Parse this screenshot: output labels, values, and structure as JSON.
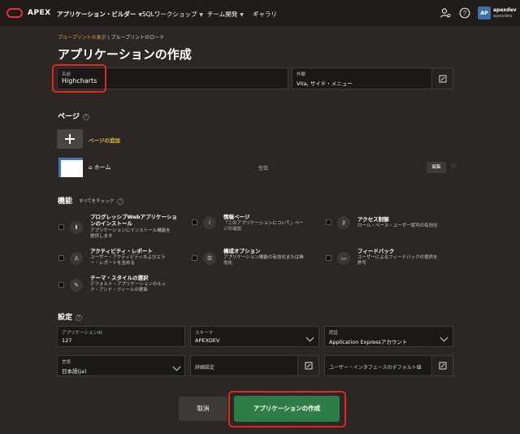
{
  "topbar": {
    "brand": "APEX",
    "nav": [
      {
        "label": "アプリケーション・ビルダー"
      },
      {
        "label": "SQLワークショップ"
      },
      {
        "label": "チーム開発"
      },
      {
        "label": "ギャラリ"
      }
    ],
    "avatar": "AP",
    "user_name": "apexdev",
    "user_workspace": "apexdev"
  },
  "breadcrumb": {
    "link": "ブループリントの表示",
    "separator": "\\",
    "current": "ブループリントのロード"
  },
  "title": "アプリケーションの作成",
  "name_field": {
    "label": "名前",
    "value": "Highcharts"
  },
  "appearance_field": {
    "label": "外観",
    "value": "Vita, サイド・メニュー"
  },
  "pages": {
    "title": "ページ",
    "add_label": "ページの追加",
    "items": [
      {
        "name": "ホーム",
        "type": "空白",
        "edit_label": "編集"
      }
    ]
  },
  "features": {
    "title": "機能",
    "check_all": "すべてをチェック",
    "items": [
      {
        "name": "プログレッシブWebアプリケーションのインストール",
        "name_l1": "プログレッシブWebアプリケーショ",
        "name_l2": "ンのインストール",
        "desc_l1": "アプリケーションにインストール機能を",
        "desc_l2": "提供します",
        "icon": "download-icon"
      },
      {
        "name": "情報ページ",
        "name_l1": "情報ページ",
        "desc_l1": "「このアプリケーションについて」ペー",
        "desc_l2": "ジの追加",
        "icon": "info-icon"
      },
      {
        "name": "アクセス制御",
        "name_l1": "アクセス制御",
        "desc_l1": "ロール・ベース・ユーザー認可の有効化",
        "icon": "key-icon"
      },
      {
        "name": "アクティビティ・レポート",
        "name_l1": "アクティビティ・レポート",
        "desc_l1": "ユーザー・アクティビティおよびエラ",
        "desc_l2": "ー・レポートを含める",
        "icon": "user-report-icon"
      },
      {
        "name": "構成オプション",
        "name_l1": "構成オプション",
        "desc_l1": "アプリケーション機能の有効化または無",
        "desc_l2": "効化",
        "icon": "sliders-icon"
      },
      {
        "name": "フィードバック",
        "name_l1": "フィードバック",
        "desc_l1": "ユーザーによるフィードバックの提供を",
        "desc_l2": "許可",
        "icon": "comment-icon"
      },
      {
        "name": "テーマ・スタイルの選択",
        "name_l1": "テーマ・スタイルの選択",
        "desc_l1": "デフォルト・アプリケーションのルッ",
        "desc_l2": "ク・アンド・フィールの更新",
        "icon": "brush-icon"
      }
    ]
  },
  "settings": {
    "title": "設定",
    "app_id": {
      "label": "アプリケーションID",
      "value": "127"
    },
    "schema": {
      "label": "スキーマ",
      "value": "APEXDEV"
    },
    "auth": {
      "label": "認証",
      "value": "Application Expressアカウント"
    },
    "language": {
      "label": "言語",
      "value": "日本語(ja)"
    },
    "advanced": {
      "label": "詳細設定"
    },
    "ui_default": {
      "label": "ユーザー・インタフェースのデフォルト値"
    }
  },
  "actions": {
    "cancel": "取消",
    "create": "アプリケーションの作成"
  },
  "colors": {
    "accent": "#e8a33c",
    "primary": "#2e7d46",
    "highlight": "#e0281e"
  }
}
